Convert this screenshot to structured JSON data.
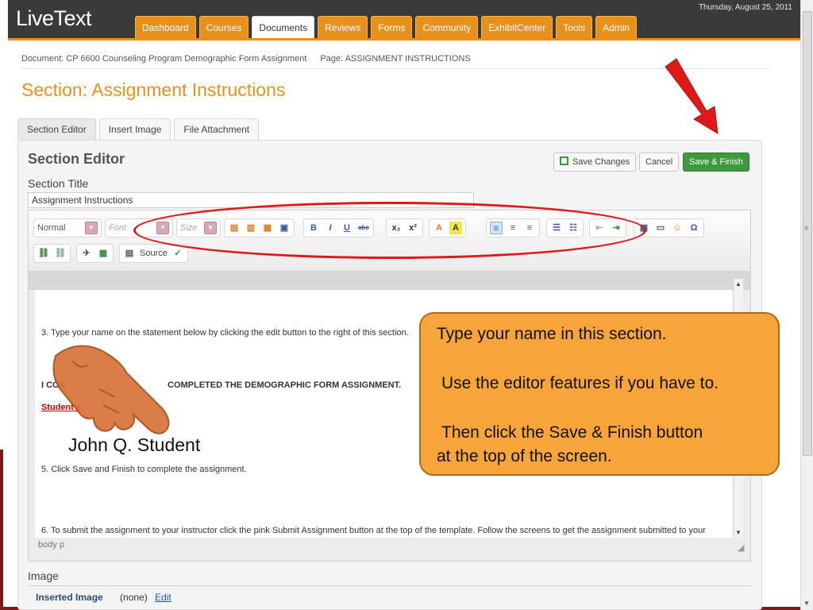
{
  "header": {
    "logo": "LiveText",
    "date": "Thursday, August 25, 2011",
    "nav": [
      "Dashboard",
      "Courses",
      "Documents",
      "Reviews",
      "Forms",
      "Community",
      "ExhibitCenter",
      "Tools",
      "Admin"
    ],
    "active_nav": "Documents"
  },
  "breadcrumb": {
    "document": "Document: CP 6600 Counseling Program Demographic Form Assignment",
    "page": "Page: ASSIGNMENT INSTRUCTIONS"
  },
  "page_title": "Section: Assignment Instructions",
  "subtabs": [
    "Section Editor",
    "Insert Image",
    "File Attachment"
  ],
  "panel": {
    "title": "Section Editor",
    "save_changes": "Save Changes",
    "cancel": "Cancel",
    "save_finish": "Save & Finish",
    "section_title_label": "Section Title",
    "section_title_value": "Assignment Instructions"
  },
  "toolbar": {
    "format": "Normal",
    "font": "Font",
    "size": "Size",
    "bold": "B",
    "italic": "I",
    "underline": "U",
    "strike": "abc",
    "subscript": "x₂",
    "superscript": "x²",
    "text_color": "A",
    "bg_color": "A",
    "source": "Source",
    "omega": "Ω"
  },
  "editor": {
    "line3": "3. Type your name on the statement below by clicking the edit button to the right of this section.",
    "statement_start": "I CON",
    "statement_end": "COMPLETED THE DEMOGRAPHIC FORM ASSIGNMENT.",
    "student_label": "Student's",
    "signature": "John Q. Student",
    "line5": "5. Click Save and Finish to complete the assignment.",
    "line6": "6. To submit the assignment to your instructor click the pink Submit Assignment button at the top of the template.  Follow the screens to get the assignment submitted to your",
    "footer": "body  p"
  },
  "image_section": {
    "label": "Image",
    "inserted_label": "Inserted Image",
    "inserted_value": "(none)",
    "edit": "Edit"
  },
  "callout": {
    "line1": "Type your name in this section.",
    "line2": "Use the editor features if you have to.",
    "line3": "Then click the Save & Finish button",
    "line4": "at the top of the screen."
  },
  "colors": {
    "accent": "#e8911a",
    "annotation_red": "#e01818",
    "callout_fill": "#f7a43a",
    "finish_green": "#3c9a3c"
  }
}
